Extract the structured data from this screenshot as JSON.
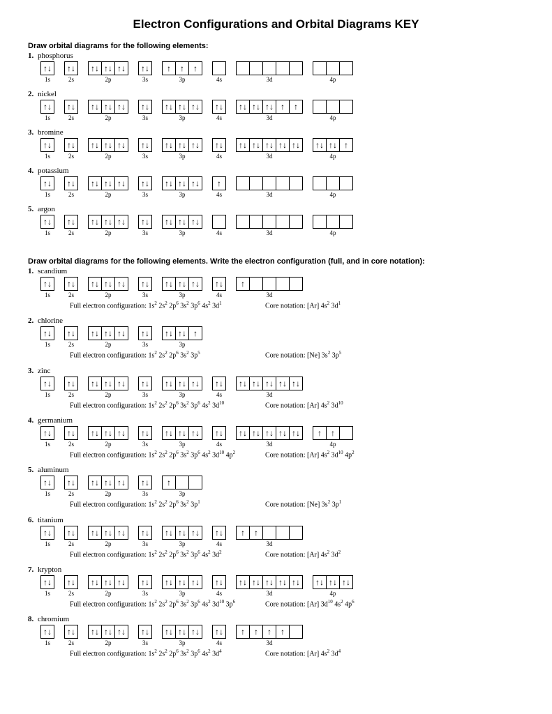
{
  "title": "Electron Configurations and Orbital Diagrams KEY",
  "section1_title": "Draw orbital diagrams for the following elements:",
  "section2_title": "Draw orbital diagrams for the following elements.  Write the electron configuration (full, and in core notation):",
  "full_label": "Full electron configuration:",
  "core_label": "Core notation:",
  "arrows": {
    "ud": "↑↓",
    "u": "↑",
    "empty": ""
  },
  "labels": {
    "1s": "1s",
    "2s": "2s",
    "2p": "2p",
    "3s": "3s",
    "3p": "3p",
    "4s": "4s",
    "3d": "3d",
    "4p": "4p"
  },
  "section1": [
    {
      "num": "1.",
      "name": "phosphorus",
      "orbitals": [
        {
          "label": "1s",
          "boxes": [
            "ud"
          ]
        },
        {
          "label": "2s",
          "boxes": [
            "ud"
          ]
        },
        {
          "label": "2p",
          "boxes": [
            "ud",
            "ud",
            "ud"
          ]
        },
        {
          "label": "3s",
          "boxes": [
            "ud"
          ]
        },
        {
          "label": "3p",
          "boxes": [
            "u",
            "u",
            "u"
          ]
        },
        {
          "label": "4s",
          "boxes": [
            "empty"
          ]
        },
        {
          "label": "3d",
          "boxes": [
            "empty",
            "empty",
            "empty",
            "empty",
            "empty"
          ]
        },
        {
          "label": "4p",
          "boxes": [
            "empty",
            "empty",
            "empty"
          ]
        }
      ]
    },
    {
      "num": "2.",
      "name": "nickel",
      "orbitals": [
        {
          "label": "1s",
          "boxes": [
            "ud"
          ]
        },
        {
          "label": "2s",
          "boxes": [
            "ud"
          ]
        },
        {
          "label": "2p",
          "boxes": [
            "ud",
            "ud",
            "ud"
          ]
        },
        {
          "label": "3s",
          "boxes": [
            "ud"
          ]
        },
        {
          "label": "3p",
          "boxes": [
            "ud",
            "ud",
            "ud"
          ]
        },
        {
          "label": "4s",
          "boxes": [
            "ud"
          ]
        },
        {
          "label": "3d",
          "boxes": [
            "ud",
            "ud",
            "ud",
            "u",
            "u"
          ]
        },
        {
          "label": "4p",
          "boxes": [
            "empty",
            "empty",
            "empty"
          ]
        }
      ]
    },
    {
      "num": "3.",
      "name": "bromine",
      "orbitals": [
        {
          "label": "1s",
          "boxes": [
            "ud"
          ]
        },
        {
          "label": "2s",
          "boxes": [
            "ud"
          ]
        },
        {
          "label": "2p",
          "boxes": [
            "ud",
            "ud",
            "ud"
          ]
        },
        {
          "label": "3s",
          "boxes": [
            "ud"
          ]
        },
        {
          "label": "3p",
          "boxes": [
            "ud",
            "ud",
            "ud"
          ]
        },
        {
          "label": "4s",
          "boxes": [
            "ud"
          ]
        },
        {
          "label": "3d",
          "boxes": [
            "ud",
            "ud",
            "ud",
            "ud",
            "ud"
          ]
        },
        {
          "label": "4p",
          "boxes": [
            "ud",
            "ud",
            "u"
          ]
        }
      ]
    },
    {
      "num": "4.",
      "name": "potassium",
      "orbitals": [
        {
          "label": "1s",
          "boxes": [
            "ud"
          ]
        },
        {
          "label": "2s",
          "boxes": [
            "ud"
          ]
        },
        {
          "label": "2p",
          "boxes": [
            "ud",
            "ud",
            "ud"
          ]
        },
        {
          "label": "3s",
          "boxes": [
            "ud"
          ]
        },
        {
          "label": "3p",
          "boxes": [
            "ud",
            "ud",
            "ud"
          ]
        },
        {
          "label": "4s",
          "boxes": [
            "u"
          ]
        },
        {
          "label": "3d",
          "boxes": [
            "empty",
            "empty",
            "empty",
            "empty",
            "empty"
          ]
        },
        {
          "label": "4p",
          "boxes": [
            "empty",
            "empty",
            "empty"
          ]
        }
      ]
    },
    {
      "num": "5.",
      "name": "argon",
      "orbitals": [
        {
          "label": "1s",
          "boxes": [
            "ud"
          ]
        },
        {
          "label": "2s",
          "boxes": [
            "ud"
          ]
        },
        {
          "label": "2p",
          "boxes": [
            "ud",
            "ud",
            "ud"
          ]
        },
        {
          "label": "3s",
          "boxes": [
            "ud"
          ]
        },
        {
          "label": "3p",
          "boxes": [
            "ud",
            "ud",
            "ud"
          ]
        },
        {
          "label": "4s",
          "boxes": [
            "empty"
          ]
        },
        {
          "label": "3d",
          "boxes": [
            "empty",
            "empty",
            "empty",
            "empty",
            "empty"
          ]
        },
        {
          "label": "4p",
          "boxes": [
            "empty",
            "empty",
            "empty"
          ]
        }
      ]
    }
  ],
  "section2": [
    {
      "num": "1.",
      "name": "scandium",
      "orbitals": [
        {
          "label": "1s",
          "boxes": [
            "ud"
          ]
        },
        {
          "label": "2s",
          "boxes": [
            "ud"
          ]
        },
        {
          "label": "2p",
          "boxes": [
            "ud",
            "ud",
            "ud"
          ]
        },
        {
          "label": "3s",
          "boxes": [
            "ud"
          ]
        },
        {
          "label": "3p",
          "boxes": [
            "ud",
            "ud",
            "ud"
          ]
        },
        {
          "label": "4s",
          "boxes": [
            "ud"
          ]
        },
        {
          "label": "3d",
          "boxes": [
            "u",
            "empty",
            "empty",
            "empty",
            "empty"
          ]
        }
      ],
      "full_html": "1s<sup>2</sup> 2s<sup>2</sup> 2p<sup>6</sup> 3s<sup>2</sup> 3p<sup>6</sup> 4s<sup>2</sup> 3d<sup>1</sup>",
      "core_html": "[Ar] 4s<sup>2</sup> 3d<sup>1</sup>"
    },
    {
      "num": "2.",
      "name": "chlorine",
      "orbitals": [
        {
          "label": "1s",
          "boxes": [
            "ud"
          ]
        },
        {
          "label": "2s",
          "boxes": [
            "ud"
          ]
        },
        {
          "label": "2p",
          "boxes": [
            "ud",
            "ud",
            "ud"
          ]
        },
        {
          "label": "3s",
          "boxes": [
            "ud"
          ]
        },
        {
          "label": "3p",
          "boxes": [
            "ud",
            "ud",
            "u"
          ]
        }
      ],
      "full_html": "1s<sup>2</sup> 2s<sup>2</sup> 2p<sup>6</sup> 3s<sup>2</sup> 3p<sup>5</sup>",
      "core_html": "[Ne] 3s<sup>2</sup> 3p<sup>5</sup>"
    },
    {
      "num": "3.",
      "name": "zinc",
      "orbitals": [
        {
          "label": "1s",
          "boxes": [
            "ud"
          ]
        },
        {
          "label": "2s",
          "boxes": [
            "ud"
          ]
        },
        {
          "label": "2p",
          "boxes": [
            "ud",
            "ud",
            "ud"
          ]
        },
        {
          "label": "3s",
          "boxes": [
            "ud"
          ]
        },
        {
          "label": "3p",
          "boxes": [
            "ud",
            "ud",
            "ud"
          ]
        },
        {
          "label": "4s",
          "boxes": [
            "ud"
          ]
        },
        {
          "label": "3d",
          "boxes": [
            "ud",
            "ud",
            "ud",
            "ud",
            "ud"
          ]
        }
      ],
      "full_html": "1s<sup>2</sup> 2s<sup>2</sup> 2p<sup>6</sup> 3s<sup>2</sup> 3p<sup>6</sup> 4s<sup>2</sup> 3d<sup>10</sup>",
      "core_html": "[Ar] 4s<sup>2</sup> 3d<sup>10</sup>"
    },
    {
      "num": "4.",
      "name": "germanium",
      "orbitals": [
        {
          "label": "1s",
          "boxes": [
            "ud"
          ]
        },
        {
          "label": "2s",
          "boxes": [
            "ud"
          ]
        },
        {
          "label": "2p",
          "boxes": [
            "ud",
            "ud",
            "ud"
          ]
        },
        {
          "label": "3s",
          "boxes": [
            "ud"
          ]
        },
        {
          "label": "3p",
          "boxes": [
            "ud",
            "ud",
            "ud"
          ]
        },
        {
          "label": "4s",
          "boxes": [
            "ud"
          ]
        },
        {
          "label": "3d",
          "boxes": [
            "ud",
            "ud",
            "ud",
            "ud",
            "ud"
          ]
        },
        {
          "label": "4p",
          "boxes": [
            "u",
            "u",
            "empty"
          ]
        }
      ],
      "full_html": "1s<sup>2</sup> 2s<sup>2</sup> 2p<sup>6</sup> 3s<sup>2</sup> 3p<sup>6</sup> 4s<sup>2</sup> 3d<sup>10</sup> 4p<sup>2</sup>",
      "core_html": "[Ar] 4s<sup>2</sup> 3d<sup>10</sup> 4p<sup>2</sup>"
    },
    {
      "num": "5.",
      "name": "aluminum",
      "orbitals": [
        {
          "label": "1s",
          "boxes": [
            "ud"
          ]
        },
        {
          "label": "2s",
          "boxes": [
            "ud"
          ]
        },
        {
          "label": "2p",
          "boxes": [
            "ud",
            "ud",
            "ud"
          ]
        },
        {
          "label": "3s",
          "boxes": [
            "ud"
          ]
        },
        {
          "label": "3p",
          "boxes": [
            "u",
            "empty",
            "empty"
          ]
        }
      ],
      "full_html": "1s<sup>2</sup> 2s<sup>2</sup> 2p<sup>6</sup> 3s<sup>2</sup> 3p<sup>1</sup>",
      "core_html": "[Ne] 3s<sup>2</sup> 3p<sup>1</sup>"
    },
    {
      "num": "6.",
      "name": "titanium",
      "orbitals": [
        {
          "label": "1s",
          "boxes": [
            "ud"
          ]
        },
        {
          "label": "2s",
          "boxes": [
            "ud"
          ]
        },
        {
          "label": "2p",
          "boxes": [
            "ud",
            "ud",
            "ud"
          ]
        },
        {
          "label": "3s",
          "boxes": [
            "ud"
          ]
        },
        {
          "label": "3p",
          "boxes": [
            "ud",
            "ud",
            "ud"
          ]
        },
        {
          "label": "4s",
          "boxes": [
            "ud"
          ]
        },
        {
          "label": "3d",
          "boxes": [
            "u",
            "u",
            "empty",
            "empty",
            "empty"
          ]
        }
      ],
      "full_html": "1s<sup>2</sup> 2s<sup>2</sup> 2p<sup>6</sup> 3s<sup>2</sup> 3p<sup>6</sup> 4s<sup>2</sup> 3d<sup>2</sup>",
      "core_html": "[Ar] 4s<sup>2</sup> 3d<sup>2</sup>"
    },
    {
      "num": "7.",
      "name": "krypton",
      "orbitals": [
        {
          "label": "1s",
          "boxes": [
            "ud"
          ]
        },
        {
          "label": "2s",
          "boxes": [
            "ud"
          ]
        },
        {
          "label": "2p",
          "boxes": [
            "ud",
            "ud",
            "ud"
          ]
        },
        {
          "label": "3s",
          "boxes": [
            "ud"
          ]
        },
        {
          "label": "3p",
          "boxes": [
            "ud",
            "ud",
            "ud"
          ]
        },
        {
          "label": "4s",
          "boxes": [
            "ud"
          ]
        },
        {
          "label": "3d",
          "boxes": [
            "ud",
            "ud",
            "ud",
            "ud",
            "ud"
          ]
        },
        {
          "label": "4p",
          "boxes": [
            "ud",
            "ud",
            "ud"
          ]
        }
      ],
      "full_html": "1s<sup>2</sup> 2s<sup>2</sup> 2p<sup>6</sup> 3s<sup>2</sup> 3p<sup>6</sup> 4s<sup>2</sup> 3d<sup>10</sup> 3p<sup>6</sup>",
      "core_html": "[Ar] 3d<sup>10</sup> 4s<sup>2</sup> 4p<sup>6</sup>"
    },
    {
      "num": "8.",
      "name": "chromium",
      "orbitals": [
        {
          "label": "1s",
          "boxes": [
            "ud"
          ]
        },
        {
          "label": "2s",
          "boxes": [
            "ud"
          ]
        },
        {
          "label": "2p",
          "boxes": [
            "ud",
            "ud",
            "ud"
          ]
        },
        {
          "label": "3s",
          "boxes": [
            "ud"
          ]
        },
        {
          "label": "3p",
          "boxes": [
            "ud",
            "ud",
            "ud"
          ]
        },
        {
          "label": "4s",
          "boxes": [
            "ud"
          ]
        },
        {
          "label": "3d",
          "boxes": [
            "u",
            "u",
            "u",
            "u",
            "empty"
          ]
        }
      ],
      "full_html": "1s<sup>2</sup> 2s<sup>2</sup> 2p<sup>6</sup> 3s<sup>2</sup> 3p<sup>6</sup> 4s<sup>2</sup> 3d<sup>4</sup>",
      "core_html": "[Ar] 4s<sup>2</sup> 3d<sup>4</sup>"
    }
  ]
}
